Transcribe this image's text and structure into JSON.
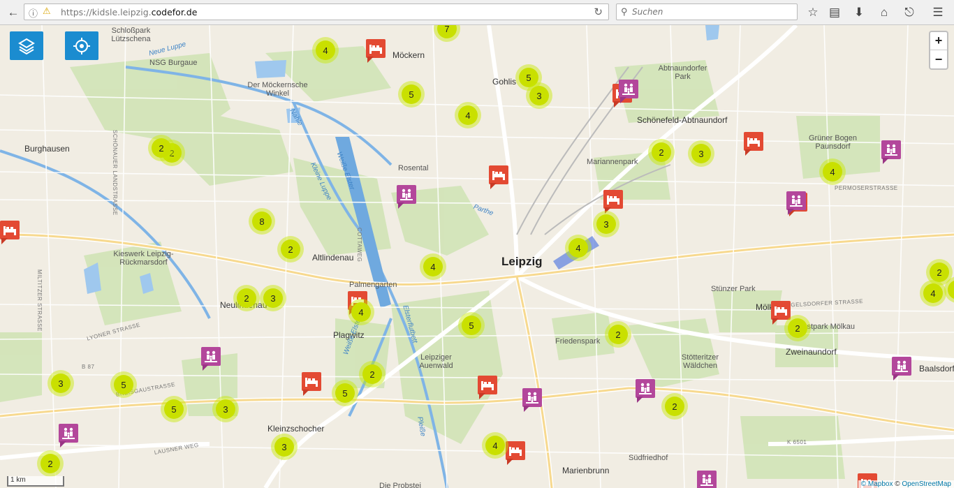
{
  "browser": {
    "url_prefix": "https://kidsle.leipzig.",
    "url_domain": "codefor.de",
    "search_placeholder": "Suchen"
  },
  "controls": {
    "layers_icon": "layers-icon",
    "locate_icon": "locate-icon",
    "zoom_in": "+",
    "zoom_out": "−"
  },
  "map": {
    "scale_label": "1 km",
    "attribution_mapbox": "© Mapbox",
    "attribution_sep": " © ",
    "attribution_osm": "OpenStreetMap",
    "labels": [
      {
        "text": "Leipzig",
        "kind": "city"
      },
      {
        "text": "Burghausen",
        "kind": "dist"
      },
      {
        "text": "Möckern",
        "kind": "dist"
      },
      {
        "text": "Gohlis",
        "kind": "dist"
      },
      {
        "text": "Abtnaundorfer Park",
        "kind": "normal"
      },
      {
        "text": "Schönefeld-Abtnaundorf",
        "kind": "dist"
      },
      {
        "text": "Mariannenpark",
        "kind": "normal"
      },
      {
        "text": "Grüner Bogen Paunsdorf",
        "kind": "normal"
      },
      {
        "text": "Rosental",
        "kind": "normal"
      },
      {
        "text": "Altlindenau",
        "kind": "dist"
      },
      {
        "text": "Palmengarten",
        "kind": "normal"
      },
      {
        "text": "Neulindenau",
        "kind": "dist"
      },
      {
        "text": "Plagwitz",
        "kind": "dist"
      },
      {
        "text": "Leipziger Auenwald",
        "kind": "normal"
      },
      {
        "text": "Friedenspark",
        "kind": "normal"
      },
      {
        "text": "Stünzer Park",
        "kind": "normal"
      },
      {
        "text": "Mölkau",
        "kind": "dist"
      },
      {
        "text": "Ostpark Mölkau",
        "kind": "normal"
      },
      {
        "text": "Zweinaundorf",
        "kind": "dist"
      },
      {
        "text": "Baalsdorf",
        "kind": "dist"
      },
      {
        "text": "Stötteritzer Wäldchen",
        "kind": "normal"
      },
      {
        "text": "Kleinzschocher",
        "kind": "dist"
      },
      {
        "text": "Südfriedhof",
        "kind": "normal"
      },
      {
        "text": "Marienbrunn",
        "kind": "dist"
      },
      {
        "text": "Die Probstei",
        "kind": "normal"
      },
      {
        "text": "Kieswerk Leipzig-Rückmarsdorf",
        "kind": "normal"
      },
      {
        "text": "NSG Burgaue",
        "kind": "normal"
      },
      {
        "text": "Der Möckernsche Winkel",
        "kind": "normal"
      },
      {
        "text": "Schloßpark Lützschena",
        "kind": "normal"
      },
      {
        "text": "Neue Luppe",
        "kind": "water"
      },
      {
        "text": "Nahle",
        "kind": "water"
      },
      {
        "text": "Weiße Elster",
        "kind": "water"
      },
      {
        "text": "Kleine Luppe",
        "kind": "water"
      },
      {
        "text": "Parthe",
        "kind": "water"
      },
      {
        "text": "Elsterflutbett",
        "kind": "water"
      },
      {
        "text": "Pleiße",
        "kind": "water"
      },
      {
        "text": "Weiße Elster",
        "kind": "water"
      },
      {
        "text": "SCHÖNAUER LANDSTRASSE",
        "kind": "street"
      },
      {
        "text": "MILTITZER STRASSE",
        "kind": "street"
      },
      {
        "text": "LYONER STRASSE",
        "kind": "street"
      },
      {
        "text": "BREISGAUSTRASSE",
        "kind": "street"
      },
      {
        "text": "LAUSNER WEG",
        "kind": "street"
      },
      {
        "text": "COTTAWEG",
        "kind": "street"
      },
      {
        "text": "PERMOSERSTRASSE",
        "kind": "street"
      },
      {
        "text": "ENGELSDORFER STRASSE",
        "kind": "street"
      },
      {
        "text": "B 87",
        "kind": "street"
      },
      {
        "text": "K 6501",
        "kind": "street"
      },
      {
        "text": "Mariannenpark",
        "kind": "normal"
      }
    ],
    "clusters": [
      "4",
      "5",
      "4",
      "5",
      "3",
      "2",
      "2",
      "8",
      "2",
      "2",
      "3",
      "4",
      "4",
      "5",
      "2",
      "5",
      "3",
      "5",
      "3",
      "2",
      "3",
      "4",
      "2",
      "4",
      "3",
      "2",
      "3",
      "4",
      "2",
      "4",
      "2",
      "2",
      "4",
      "2",
      "7"
    ],
    "pois": [
      "red",
      "red",
      "purple",
      "red",
      "purple",
      "purple",
      "red",
      "red",
      "red",
      "red",
      "red",
      "purple",
      "red",
      "red",
      "purple",
      "purple",
      "red",
      "purple",
      "purple",
      "purple",
      "red",
      "purple",
      "red"
    ]
  }
}
